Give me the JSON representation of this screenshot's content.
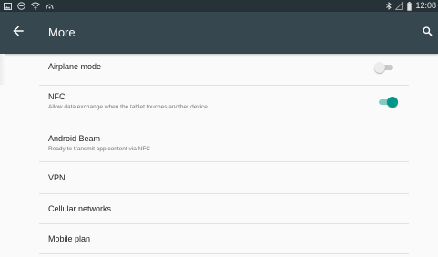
{
  "status_bar": {
    "time": "12:08",
    "left_icons": [
      "picture-icon",
      "dnd-icon",
      "wifi-icon",
      "signal-icon"
    ],
    "right_icons": [
      "bluetooth-icon",
      "cell-signal-icon",
      "battery-icon"
    ]
  },
  "toolbar": {
    "title": "More",
    "back_icon": "arrow-back-icon",
    "search_icon": "search-icon"
  },
  "items": [
    {
      "title": "Airplane mode",
      "summary": "",
      "switch": "off"
    },
    {
      "title": "NFC",
      "summary": "Allow data exchange when the tablet touches another device",
      "switch": "on"
    },
    {
      "title": "Android Beam",
      "summary": "Ready to transmit app content via NFC"
    },
    {
      "title": "VPN",
      "summary": ""
    },
    {
      "title": "Cellular networks",
      "summary": ""
    },
    {
      "title": "Mobile plan",
      "summary": ""
    }
  ],
  "colors": {
    "status_bar": "#263238",
    "toolbar": "#37474f",
    "accent": "#009688",
    "background": "#fafafa"
  }
}
